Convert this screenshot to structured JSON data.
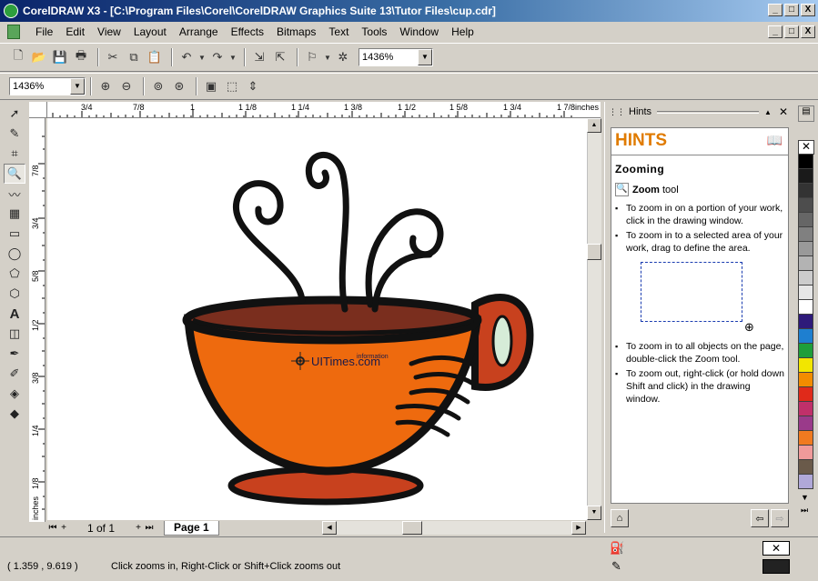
{
  "window": {
    "title": "CorelDRAW X3 - [C:\\Program Files\\Corel\\CorelDRAW Graphics Suite 13\\Tutor Files\\cup.cdr]",
    "minimize": "_",
    "maximize": "□",
    "close": "X"
  },
  "menu": [
    "File",
    "Edit",
    "View",
    "Layout",
    "Arrange",
    "Effects",
    "Bitmaps",
    "Text",
    "Tools",
    "Window",
    "Help"
  ],
  "toolbar": {
    "zoom_level": "1436%"
  },
  "property_bar": {
    "zoom_level": "1436%"
  },
  "ruler": {
    "units": "inches",
    "top_ticks": [
      "3/4",
      "7/8",
      "1",
      "1 1/8",
      "1 1/4",
      "1 3/8",
      "1 1/2",
      "1 5/8",
      "1 3/4",
      "1 7/8"
    ],
    "side_ticks": [
      "7/8",
      "3/4",
      "5/8",
      "1/2",
      "3/8",
      "1/4",
      "1/8"
    ]
  },
  "canvas": {
    "watermark": "UITimes.com",
    "watermark_sup": "information"
  },
  "pagebar": {
    "page_count": "1 of 1",
    "page_tab": "Page 1"
  },
  "docker": {
    "tab_label": "Hints",
    "heading": "HINTS",
    "subheading": "Zooming",
    "tool_name": "Zoom",
    "tool_suffix": "tool",
    "hints": [
      "To zoom in on a portion of your work, click in the drawing window.",
      "To zoom in to a selected area of your work, drag to define the area.",
      "To zoom in to all objects on the page, double-click the Zoom tool.",
      "To zoom out, right-click (or hold down Shift and click) in the drawing window."
    ]
  },
  "palette_colors": [
    "#000000",
    "#1a1a1a",
    "#333333",
    "#4d4d4d",
    "#666666",
    "#808080",
    "#999999",
    "#b3b3b3",
    "#cccccc",
    "#e6e6e6",
    "#ffffff",
    "#2e1a7a",
    "#1e7fd0",
    "#1e9e3a",
    "#f2e600",
    "#f28c00",
    "#e02a1a",
    "#c0306a",
    "#9a3a8a",
    "#f07a20",
    "#f09a9a",
    "#6a5a4a",
    "#b0a8d8"
  ],
  "status": {
    "coords": "( 1.359 , 9.619 )",
    "message": "Click zooms in, Right-Click or Shift+Click zooms out"
  }
}
